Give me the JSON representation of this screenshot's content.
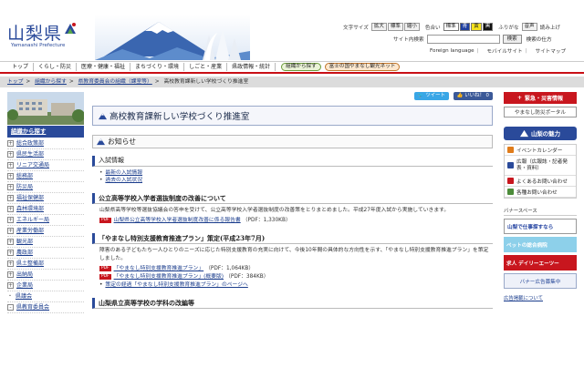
{
  "header": {
    "logo_kanji": "山梨県",
    "logo_roman": "Yamanashi Prefecture",
    "font_size": {
      "label": "文字サイズ",
      "options": [
        "拡大",
        "標準",
        "縮小"
      ]
    },
    "color": {
      "label": "色合い",
      "options": [
        "標準",
        "青",
        "黄",
        "黒"
      ]
    },
    "furigana": "ふりがな",
    "audio": "音声",
    "read_aloud": "読み上げ",
    "site_search_label": "サイト内検索",
    "search_input_value": "",
    "search_button": "検索",
    "search_help": "検索の仕方",
    "foreign_language": "Foreign language",
    "mobile_site": "モバイルサイト",
    "site_map": "サイトマップ"
  },
  "global_nav": {
    "items": [
      "トップ",
      "くらし・防災",
      "医療・健康・福祉",
      "まちづくり・環境",
      "しごと・産業",
      "県政情報・統計"
    ],
    "pills": [
      "組織から探す",
      "富士の国やまなし観光ネット"
    ]
  },
  "breadcrumb": [
    "トップ",
    "組織から探す",
    "県教育委員会の組織（課室等）"
  ],
  "breadcrumb_current": "高校教育課新しい学校づくり推進室",
  "left_nav": {
    "title": "組織から探す",
    "items": [
      {
        "label": "総合政策部",
        "marker": "+"
      },
      {
        "label": "県民生活部",
        "marker": "+"
      },
      {
        "label": "リニア交通局",
        "marker": "+"
      },
      {
        "label": "総務部",
        "marker": "+"
      },
      {
        "label": "防災局",
        "marker": "+"
      },
      {
        "label": "福祉保健部",
        "marker": "+"
      },
      {
        "label": "森林環境部",
        "marker": "+"
      },
      {
        "label": "エネルギー局",
        "marker": "+"
      },
      {
        "label": "産業労働部",
        "marker": "+"
      },
      {
        "label": "観光部",
        "marker": "+"
      },
      {
        "label": "農政部",
        "marker": "+"
      },
      {
        "label": "県土整備部",
        "marker": "+"
      },
      {
        "label": "出納局",
        "marker": "+"
      },
      {
        "label": "企業局",
        "marker": "+"
      },
      {
        "label": "県議会",
        "marker": "・"
      },
      {
        "label": "県教育委員会",
        "marker": "-"
      }
    ]
  },
  "social": {
    "tweet": "ツイート",
    "like": "いいね！ 0"
  },
  "main": {
    "title": "高校教育課新しい学校づくり推進室",
    "notice_heading": "お知らせ",
    "sections": {
      "exam": {
        "heading": "入試情報",
        "links": [
          "最新の入試情報",
          "過去の入試状況"
        ]
      },
      "reform": {
        "heading": "公立高等学校入学者選抜制度の改善について",
        "text": "山梨県高等学校等選抜協議会の答申を受けて、公立高等学校入学者選抜制度の改善策をとりまとめました。平成27年度入試から実施していきます。",
        "pdf_link": "山梨県公立高等学校入学者選抜制度改善に係る報告書",
        "pdf_size": "（PDF：1,330KB）"
      },
      "plan": {
        "heading": "「やまなし特別支援教育推進プラン」策定(平成23年7月)",
        "text": "障害のある子どもたち一人ひとりのニーズに応じた特別支援教育の充実に向けて、今後10年間の具体的な方向性を示す、「やまなし特別支援教育推進プラン」を策定しました。",
        "pdf_links": [
          {
            "label": "「やまなし特別支援教育推進プラン」",
            "size": "（PDF：1,064KB）"
          },
          {
            "label": "「やまなし特別支援教育推進プラン」(概要版)",
            "size": "（PDF：384KB）"
          }
        ],
        "process_link": "策定の経過「やまなし特別支援教育推進プラン」のページへ"
      },
      "reorg": {
        "heading": "山梨県立高等学校の学科の改編等"
      }
    }
  },
  "right_nav": {
    "emergency": "緊急・災害情報",
    "disaster_portal": "やまなし防災ポータル",
    "charm": "山梨の魅力",
    "items": [
      "イベントカレンダー",
      "広報（広報誌・記者発表・資料）",
      "よくあるお問い合わせ",
      "各種お問い合わせ"
    ],
    "ad_space": "バナースペース",
    "banners": [
      "山梨で仕事探すなら",
      "ペットの総合病院",
      "求人 デイリーエーツー",
      "バナー広告募集中"
    ],
    "ad_link": "広告掲載について"
  },
  "colors": {
    "brand_blue": "#2a4a9a",
    "brand_red": "#c8161e",
    "breadcrumb_bg": "#dcdcdc"
  }
}
